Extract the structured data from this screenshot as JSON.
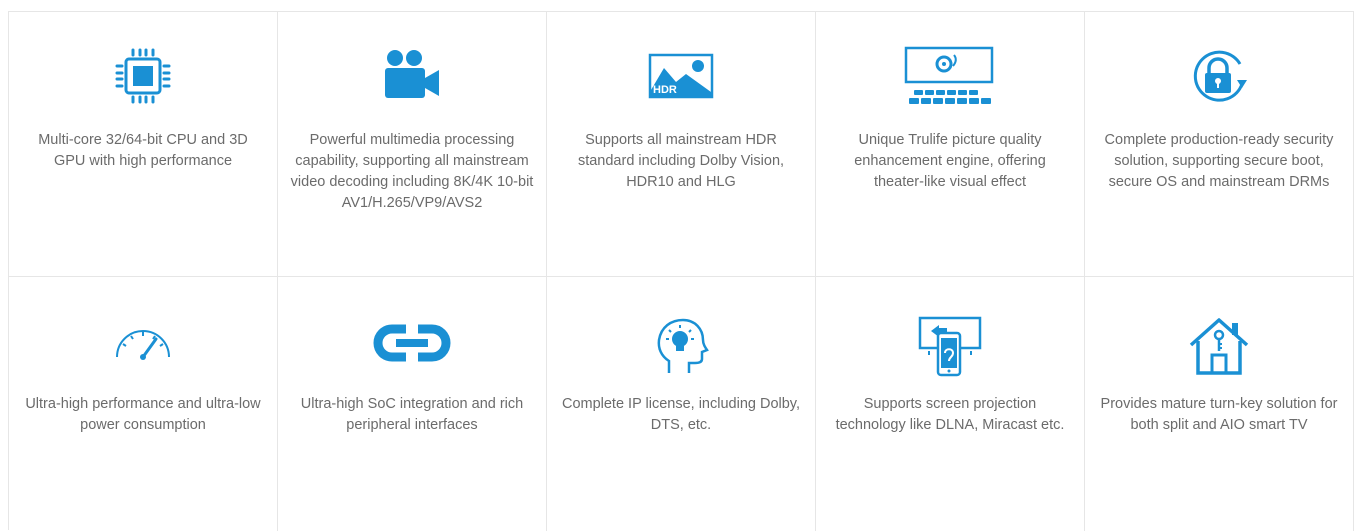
{
  "theme": {
    "accent": "#1a90d4",
    "text": "#6b6b6b",
    "border": "#e6e6e6"
  },
  "features": [
    {
      "icon": "cpu-chip-icon",
      "text": "Multi-core 32/64-bit CPU and 3D GPU with high performance"
    },
    {
      "icon": "video-camera-icon",
      "text": "Powerful multimedia processing capability, supporting all mainstream video decoding including 8K/4K 10-bit AV1/H.265/VP9/AVS2"
    },
    {
      "icon": "hdr-image-icon",
      "text": "Supports all mainstream HDR standard including Dolby Vision, HDR10 and HLG",
      "icon_label": "HDR"
    },
    {
      "icon": "theater-screen-icon",
      "text": "Unique Trulife picture quality enhancement engine, offering theater-like visual effect"
    },
    {
      "icon": "security-lock-icon",
      "text": "Complete production-ready security solution, supporting secure boot, secure OS and mainstream DRMs"
    },
    {
      "icon": "speedometer-icon",
      "text": "Ultra-high performance and ultra-low power consumption"
    },
    {
      "icon": "link-icon",
      "text": "Ultra-high SoC integration and rich peripheral interfaces"
    },
    {
      "icon": "head-lightbulb-icon",
      "text": "Complete IP license, including Dolby, DTS, etc."
    },
    {
      "icon": "screen-projection-icon",
      "text": "Supports screen projection technology like DLNA, Miracast etc."
    },
    {
      "icon": "smart-home-icon",
      "text": "Provides mature turn-key solution for both split and AIO smart TV"
    }
  ]
}
